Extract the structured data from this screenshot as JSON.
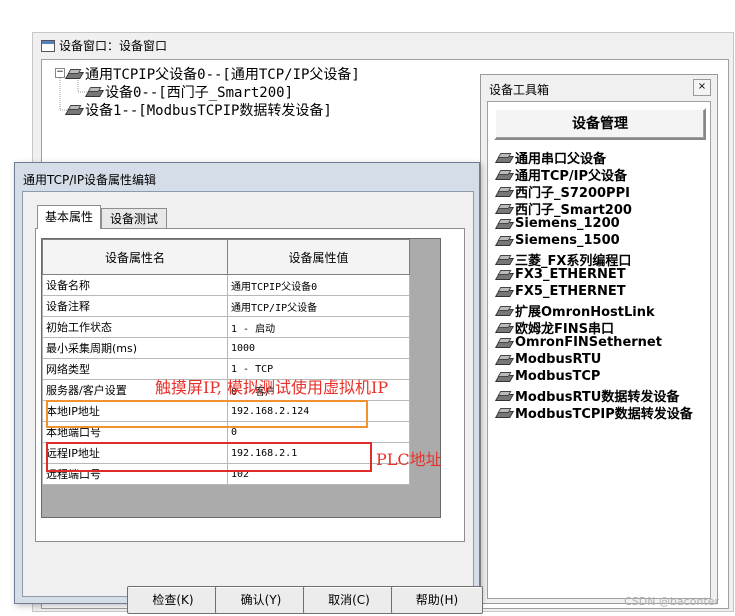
{
  "device_window": {
    "title": "设备窗口：设备窗口",
    "tree": [
      {
        "label": "通用TCPIP父设备0--[通用TCP/IP父设备]",
        "level": 0
      },
      {
        "label": "设备0--[西门子_Smart200]",
        "level": 1
      },
      {
        "label": "设备1--[ModbusTCPIP数据转发设备]",
        "level": 0
      }
    ]
  },
  "toolbox": {
    "title": "设备工具箱",
    "close": "×",
    "manage_button": "设备管理",
    "items": [
      "通用串口父设备",
      "通用TCP/IP父设备",
      "西门子_S7200PPI",
      "西门子_Smart200",
      "Siemens_1200",
      "Siemens_1500",
      "三菱_FX系列编程口",
      "FX3_ETHERNET",
      "FX5_ETHERNET",
      "扩展OmronHostLink",
      "欧姆龙FINS串口",
      "OmronFINSethernet",
      "ModbusRTU",
      "ModbusTCP",
      "ModbusRTU数据转发设备",
      "ModbusTCPIP数据转发设备"
    ]
  },
  "dialog": {
    "title": "通用TCP/IP设备属性编辑",
    "tabs": [
      "基本属性",
      "设备测试"
    ],
    "header_name": "设备属性名",
    "header_value": "设备属性值",
    "rows": [
      {
        "name": "设备名称",
        "value": "通用TCPIP父设备0"
      },
      {
        "name": "设备注释",
        "value": "通用TCP/IP父设备"
      },
      {
        "name": "初始工作状态",
        "value": "1 - 启动"
      },
      {
        "name": "最小采集周期(ms)",
        "value": "1000"
      },
      {
        "name": "网络类型",
        "value": "1 - TCP"
      },
      {
        "name": "服务器/客户设置",
        "value": "0 - 客户"
      },
      {
        "name": "本地IP地址",
        "value": "192.168.2.124"
      },
      {
        "name": "本地端口号",
        "value": "0"
      },
      {
        "name": "远程IP地址",
        "value": "192.168.2.1"
      },
      {
        "name": "远程端口号",
        "value": "102"
      }
    ],
    "buttons": [
      "检查(K)",
      "确认(Y)",
      "取消(C)",
      "帮助(H)"
    ]
  },
  "annotations": {
    "local_ip_note": "触摸屏IP, 模拟测试使用虚拟机IP",
    "remote_ip_note": "PLC地址",
    "orange": "#f0922e",
    "red": "#e02b2b"
  },
  "watermark": "CSDN @baconter"
}
